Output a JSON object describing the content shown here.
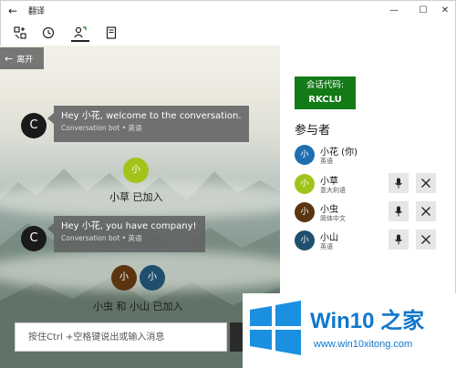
{
  "window": {
    "title": "翻译"
  },
  "chat": {
    "leave_label": "离开",
    "messages": [
      {
        "avatar": "C",
        "text": "Hey 小花, welcome to the conversation.",
        "sender": "Conversation bot • 英语"
      },
      {
        "avatar": "C",
        "text": "Hey 小花, you have company!",
        "sender": "Conversation bot • 英语"
      }
    ],
    "joins": [
      {
        "avatars": [
          "小"
        ],
        "text": "小草 已加入"
      },
      {
        "avatars": [
          "小",
          "小"
        ],
        "text": "小虫 和 小山 已加入"
      }
    ],
    "input_placeholder": "按住Ctrl +空格键说出或输入消息"
  },
  "panel": {
    "code_label": "会话代码:",
    "code_value": "RKCLU",
    "participants_title": "参与者",
    "participants": [
      {
        "avatar": "小",
        "name": "小花 (你)",
        "lang": "英语",
        "color": "#1e6fb0",
        "controls": false
      },
      {
        "avatar": "小",
        "name": "小草",
        "lang": "意大利语",
        "color": "#a2c41a",
        "controls": true
      },
      {
        "avatar": "小",
        "name": "小虫",
        "lang": "简体中文",
        "color": "#5a3510",
        "controls": true
      },
      {
        "avatar": "小",
        "name": "小山",
        "lang": "英语",
        "color": "#1f4f6c",
        "controls": true
      }
    ]
  },
  "colors": {
    "code_box": "#127a17",
    "grass": "#a2c41a",
    "bug": "#5a3510",
    "mountain": "#1f4f6c"
  },
  "watermark": {
    "brand": "Win10 之家",
    "url": "www.win10xitong.com"
  }
}
